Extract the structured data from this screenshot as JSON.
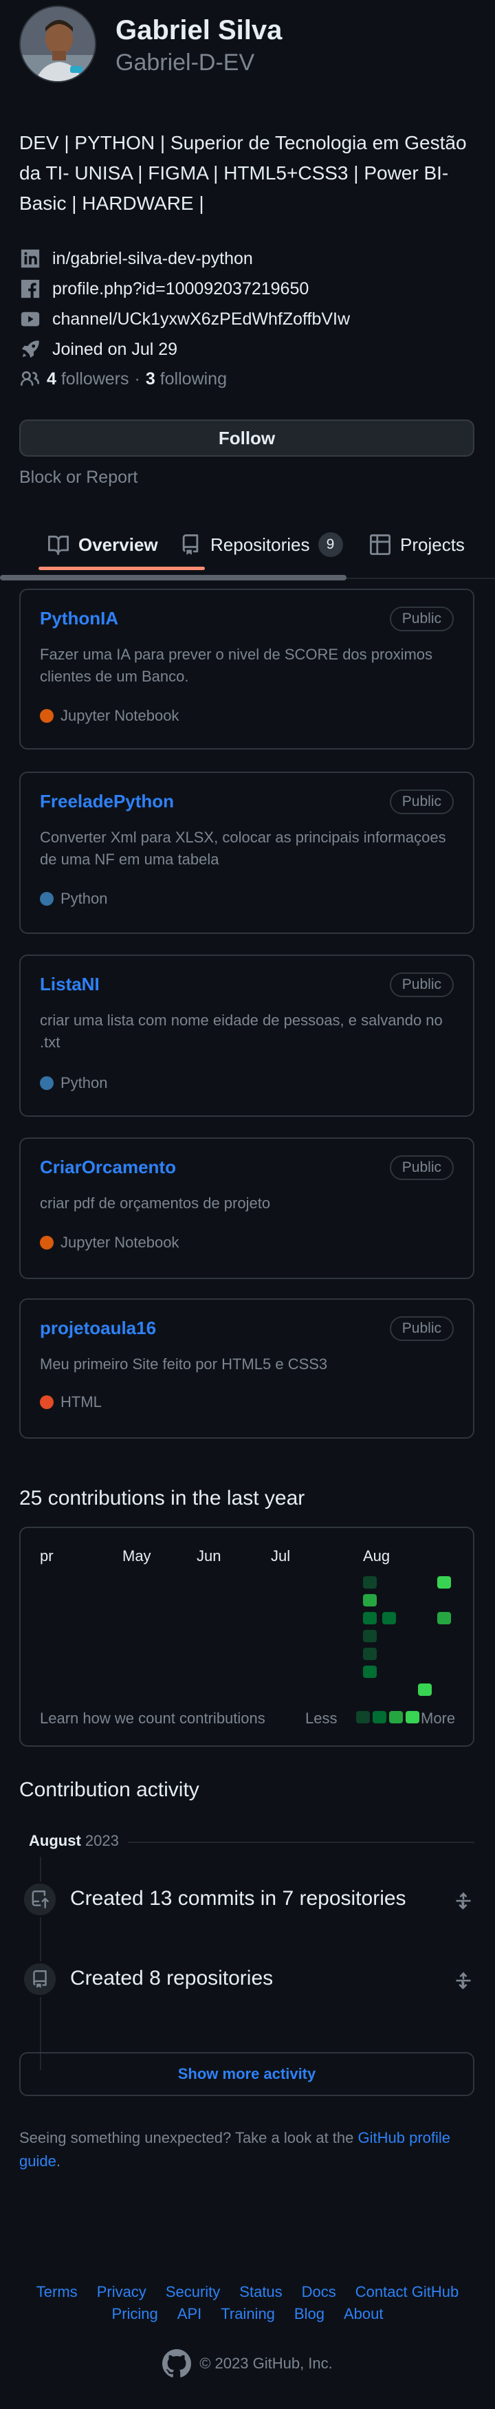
{
  "profile": {
    "name": "Gabriel Silva",
    "username": "Gabriel-D-EV",
    "bio": "DEV | PYTHON | Superior de Tecnologia em Gestão da TI- UNISA | FIGMA | HTML5+CSS3 | Power BI-Basic | HARDWARE |",
    "linkedin": "in/gabriel-silva-dev-python",
    "facebook": "profile.php?id=100092037219650",
    "youtube": "channel/UCk1yxwX6zPEdWhfZoffbVIw",
    "joined": "Joined on Jul 29",
    "followers_count": "4",
    "followers_label": "followers",
    "separator": "·",
    "following_count": "3",
    "following_label": "following",
    "follow_button": "Follow",
    "block_report": "Block or Report"
  },
  "tabs": [
    {
      "label": "Overview",
      "icon": "book-icon",
      "active": true
    },
    {
      "label": "Repositories",
      "icon": "repo-icon",
      "count": "9"
    },
    {
      "label": "Projects",
      "icon": "table-icon"
    }
  ],
  "repos": [
    {
      "name": "PythonIA",
      "visibility": "Public",
      "description": "Fazer uma IA para prever o nivel de SCORE dos proximos clientes de um Banco.",
      "language": "Jupyter Notebook",
      "lang_color": "#da5b0b"
    },
    {
      "name": "FreeladePython",
      "visibility": "Public",
      "description": "Converter Xml para XLSX, colocar as principais informaçoes de uma NF em uma tabela",
      "language": "Python",
      "lang_color": "#3572a5"
    },
    {
      "name": "ListaNI",
      "visibility": "Public",
      "description": "criar uma lista com nome eidade de pessoas, e salvando no .txt",
      "language": "Python",
      "lang_color": "#3572a5"
    },
    {
      "name": "CriarOrcamento",
      "visibility": "Public",
      "description": "criar pdf de orçamentos de projeto",
      "language": "Jupyter Notebook",
      "lang_color": "#da5b0b"
    },
    {
      "name": "projetoaula16",
      "visibility": "Public",
      "description": "Meu primeiro Site feito por HTML5 e CSS3",
      "language": "HTML",
      "lang_color": "#e34c26"
    }
  ],
  "contributions": {
    "title": "25 contributions in the last year",
    "months": [
      "pr",
      "May",
      "Jun",
      "Jul",
      "Aug"
    ],
    "learn": "Learn how we count contributions",
    "less": "Less",
    "more": "More",
    "colors": [
      "#0e4429",
      "#006d32",
      "#26a641",
      "#39d353"
    ]
  },
  "activity": {
    "title": "Contribution activity",
    "month": "August",
    "year": "2023",
    "items": [
      {
        "text": "Created 13 commits in 7 repositories",
        "icon": "repo-push-icon"
      },
      {
        "text": "Created 8 repositories",
        "icon": "repo-icon"
      }
    ],
    "show_more": "Show more activity",
    "unexpected_text": "Seeing something unexpected? Take a look at the ",
    "unexpected_link": "GitHub profile guide",
    "unexpected_end": "."
  },
  "footer": {
    "row1": [
      "Terms",
      "Privacy",
      "Security",
      "Status",
      "Docs",
      "Contact GitHub"
    ],
    "row2": [
      "Pricing",
      "API",
      "Training",
      "Blog",
      "About"
    ],
    "copyright": "© 2023 GitHub, Inc."
  }
}
